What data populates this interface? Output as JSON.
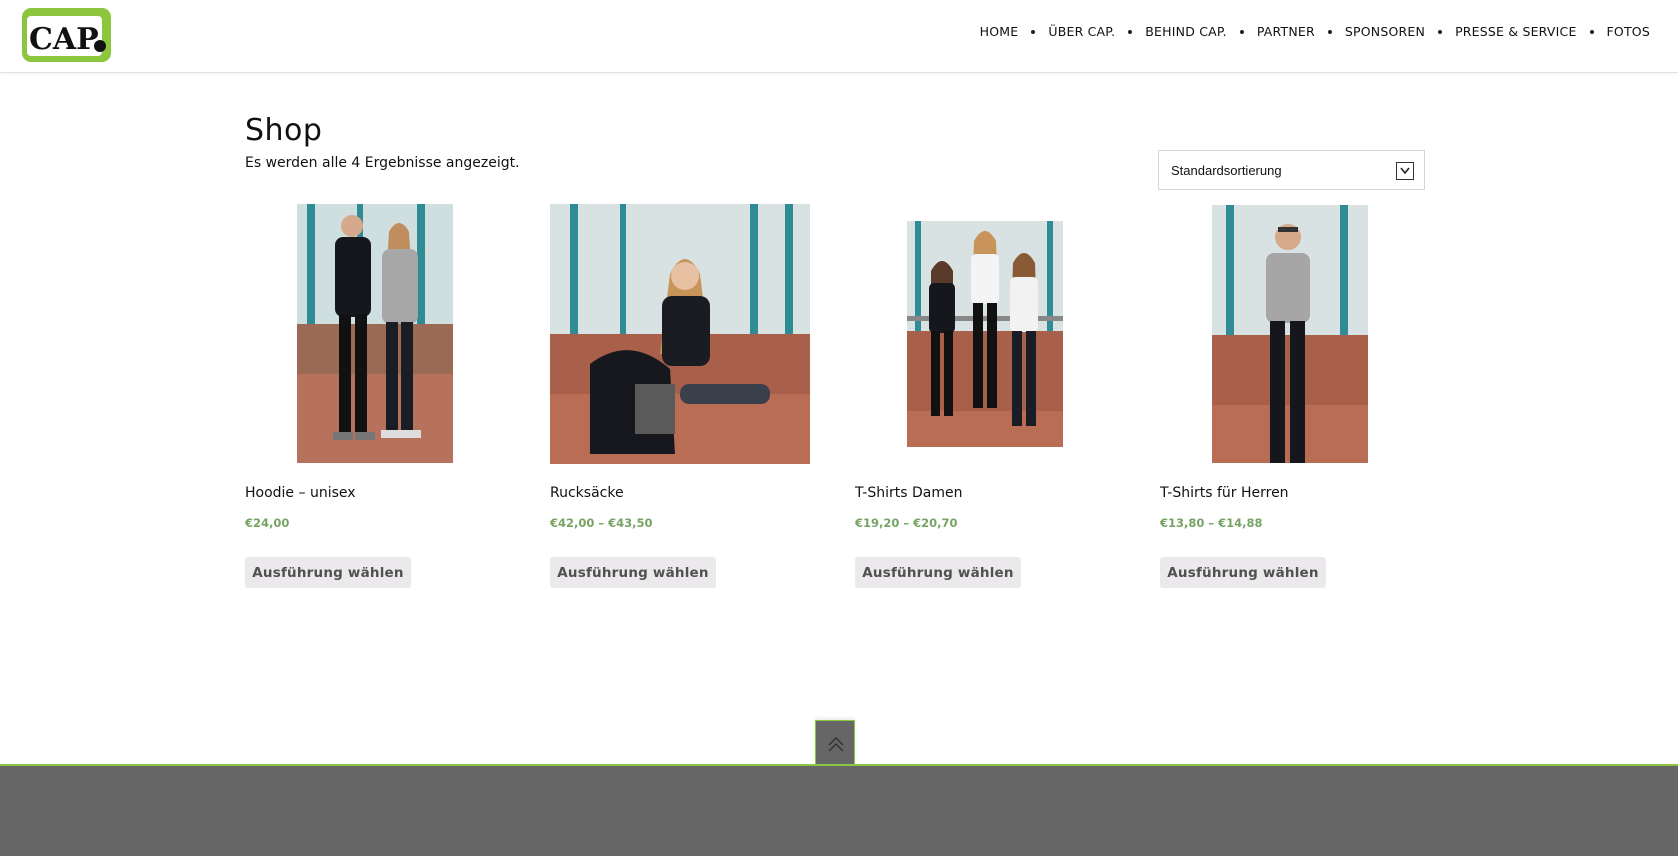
{
  "header": {
    "logo_text": "CAP.",
    "logo_colors": {
      "green": "#8cc63f",
      "black": "#111111"
    },
    "nav": [
      {
        "label": "HOME"
      },
      {
        "label": "ÜBER CAP."
      },
      {
        "label": "BEHIND CAP."
      },
      {
        "label": "PARTNER"
      },
      {
        "label": "SPONSOREN"
      },
      {
        "label": "PRESSE & SERVICE"
      },
      {
        "label": "FOTOS"
      }
    ]
  },
  "main": {
    "title": "Shop",
    "result_count": "Es werden alle 4 Ergebnisse angezeigt.",
    "sort": {
      "selected": "Standardsortierung",
      "icon": "chevron-down-icon"
    },
    "products": [
      {
        "name": "Hoodie – unisex",
        "price": "€24,00",
        "button": "Ausführung wählen",
        "image": "photo-hoodie-couple"
      },
      {
        "name": "Rucksäcke",
        "price": "€42,00 – €43,50",
        "button": "Ausführung wählen",
        "image": "photo-backpack-girl"
      },
      {
        "name": "T-Shirts Damen",
        "price": "€19,20 – €20,70",
        "button": "Ausführung wählen",
        "image": "photo-three-girls"
      },
      {
        "name": "T-Shirts für Herren",
        "price": "€13,80 – €14,88",
        "button": "Ausführung wählen",
        "image": "photo-boy-tshirt"
      }
    ],
    "price_color": "#77a464"
  },
  "footer": {
    "background": "#666666",
    "accent": "#8cc63f",
    "scroll_top_icon": "double-chevron-up-icon"
  }
}
